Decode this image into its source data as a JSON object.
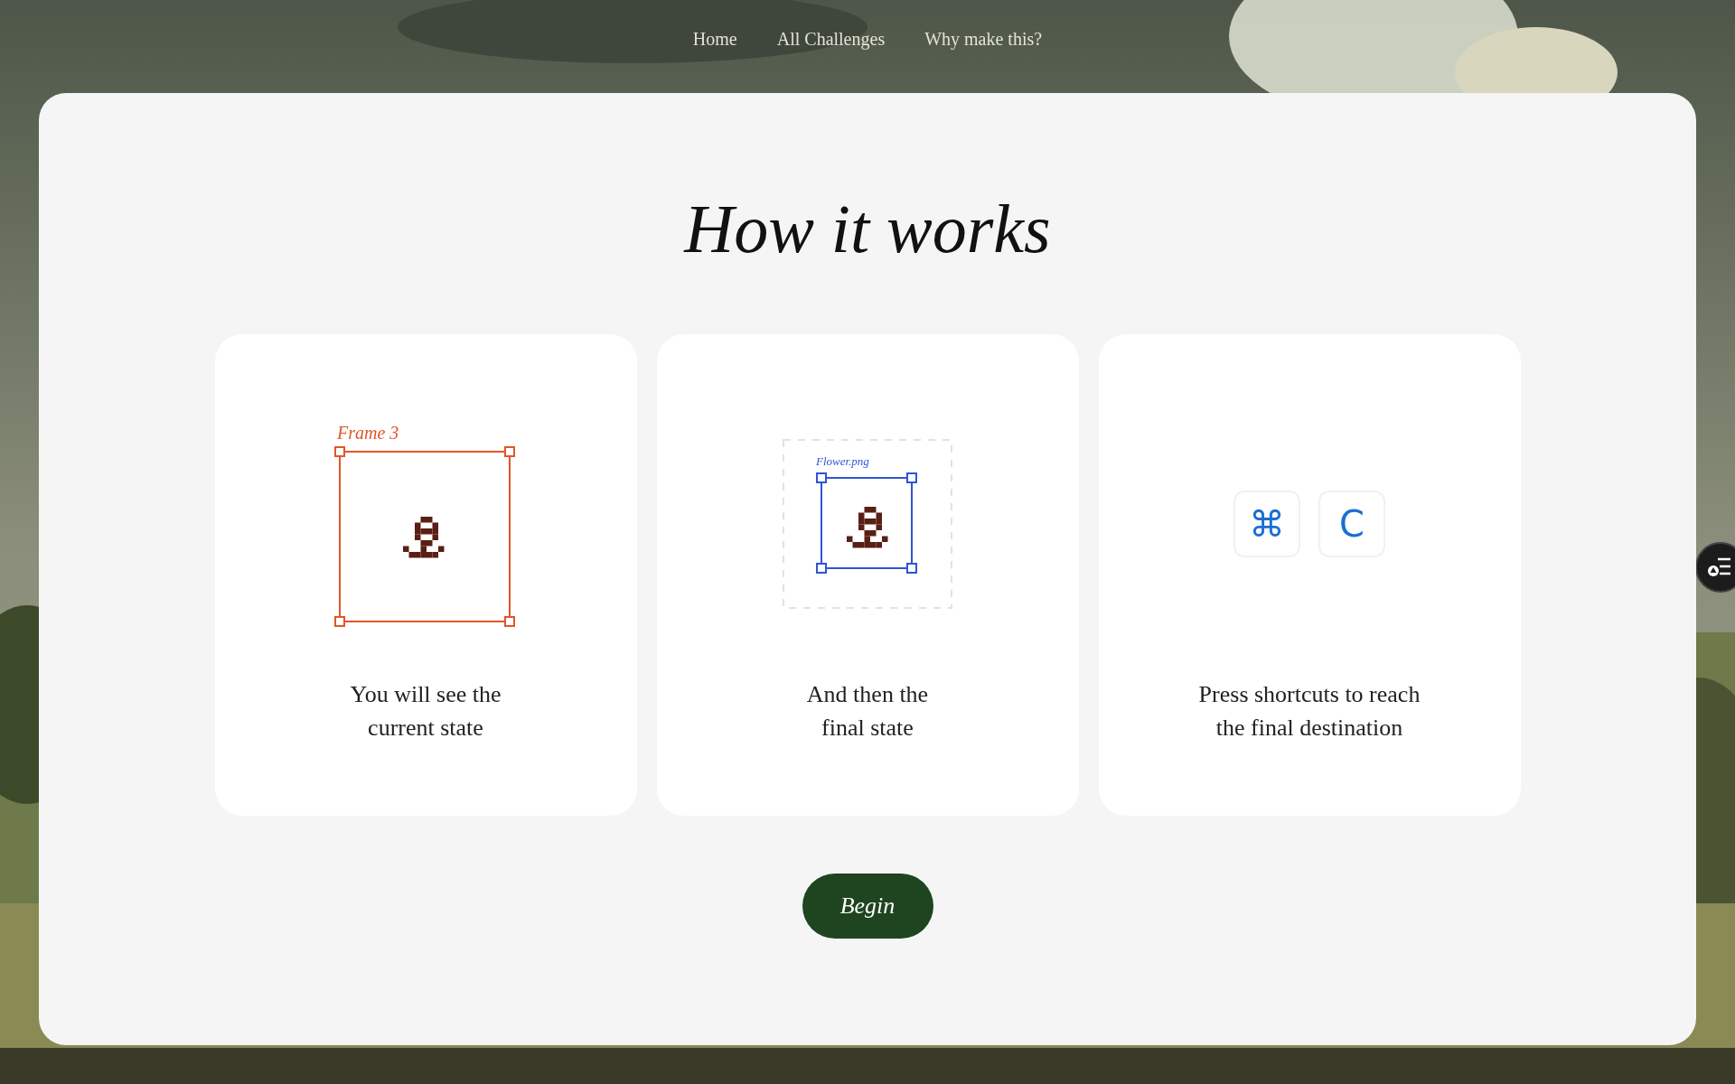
{
  "nav": [
    "Home",
    "All Challenges",
    "Why make this?"
  ],
  "title": "How it works",
  "cards": [
    {
      "kind": "frame",
      "label": "Frame 3",
      "caption": "You will see the\ncurrent state"
    },
    {
      "label": "Flower.png",
      "caption": "And then the\nfinal state"
    },
    {
      "kind": "shortcut",
      "keys": [
        "⌘",
        "C"
      ],
      "caption": "Press shortcuts to reach\nthe final destination"
    }
  ],
  "button": "Begin"
}
